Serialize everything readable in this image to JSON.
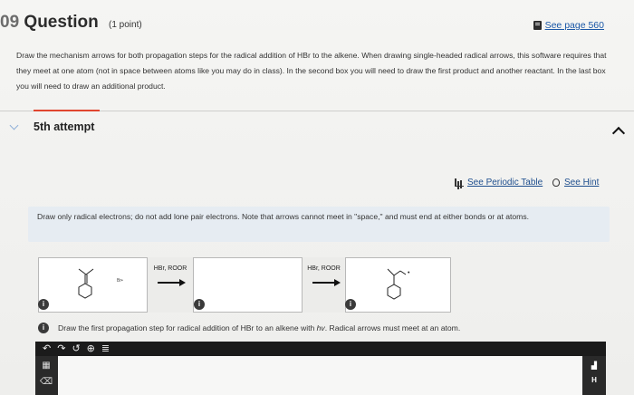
{
  "question": {
    "number": "09",
    "title": "Question",
    "points": "(1 point)",
    "see_page": "See page 560",
    "prompt": "Draw the mechanism arrows for both propagation steps for the radical addition of HBr to the alkene. When drawing single-headed radical arrows, this software requires that they meet at one atom (not in space between atoms like you may do in class). In the second box you will need to draw the first product and another reactant. In the last box you will need to draw an additional product."
  },
  "attempt": {
    "label": "5th attempt"
  },
  "tools": {
    "periodic_table": "See Periodic Table",
    "hint": "See Hint"
  },
  "notice": "Draw only radical electrons; do not add lone pair electrons. Note that arrows cannot meet in \"space,\" and must end at either bonds or at atoms.",
  "scheme": {
    "reagent1": "HBr, ROOR",
    "reagent2": "HBr, ROOR",
    "box1_radical_label": "Br•",
    "box3_radical_dot": "•"
  },
  "instruction": {
    "prefix": "Draw the first propagation step for radical addition of HBr to an alkene with ",
    "hv": "hv",
    "suffix": ". Radical arrows must meet at an atom."
  },
  "editor": {
    "toolbar_icons": [
      "undo-icon",
      "redo-icon",
      "reset-icon",
      "zoom-icon",
      "template-icon"
    ],
    "right_label": "H",
    "info_glyph": "i"
  },
  "colors": {
    "accent_rule": "#e0462f",
    "link": "#1a57a6",
    "notice_bg": "#e6ecf2"
  }
}
